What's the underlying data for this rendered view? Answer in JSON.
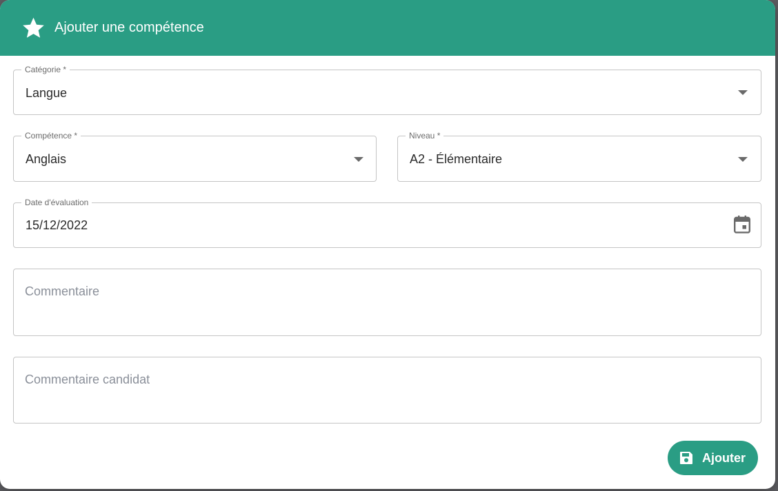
{
  "dialog": {
    "title": "Ajouter une compétence",
    "header_icon": "star-icon",
    "accent_color": "#2a9d84"
  },
  "form": {
    "categorie": {
      "label": "Catégorie *",
      "value": "Langue"
    },
    "competence": {
      "label": "Compétence *",
      "value": "Anglais"
    },
    "niveau": {
      "label": "Niveau *",
      "value": "A2 - Élémentaire"
    },
    "date_evaluation": {
      "label": "Date d'évaluation",
      "value": "15/12/2022",
      "icon": "calendar-icon"
    },
    "commentaire": {
      "placeholder": "Commentaire"
    },
    "commentaire_candidat": {
      "placeholder": "Commentaire candidat"
    }
  },
  "actions": {
    "submit_label": "Ajouter",
    "submit_icon": "save-icon"
  }
}
